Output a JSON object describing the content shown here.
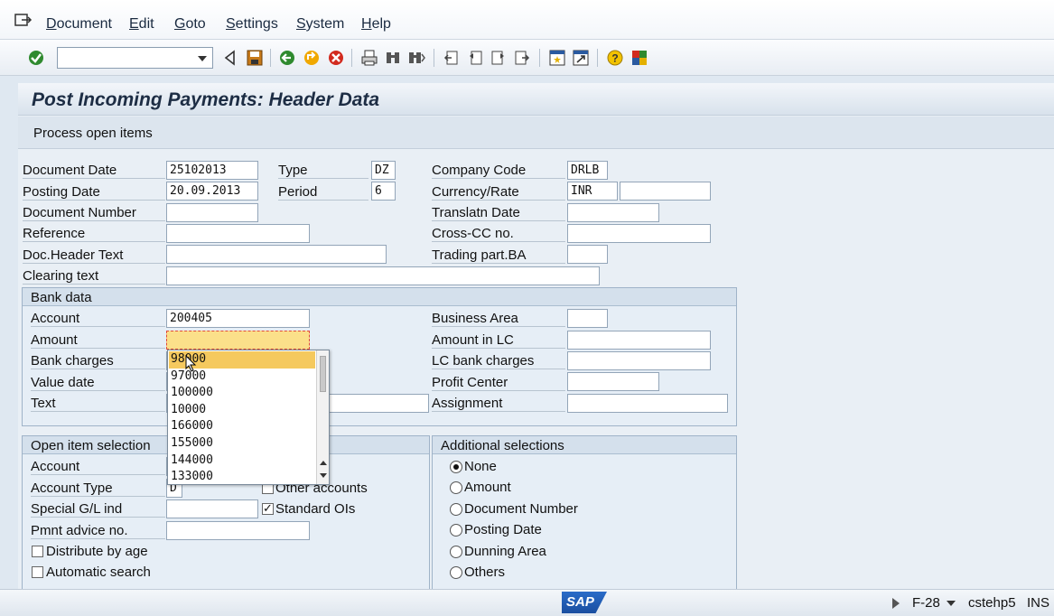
{
  "menu": {
    "icon": "menu-exit-icon",
    "items": [
      "Document",
      "Edit",
      "Goto",
      "Settings",
      "System",
      "Help"
    ]
  },
  "toolbar": {
    "command_value": "",
    "icons": [
      "enter-icon",
      "back-triangle-icon",
      "save-icon",
      "back-icon",
      "exit-icon",
      "cancel-icon",
      "print-icon",
      "find-icon",
      "find-next-icon",
      "first-page-icon",
      "previous-page-icon",
      "next-page-icon",
      "last-page-icon",
      "create-session-icon",
      "shortcut-icon",
      "help-icon",
      "customize-layout-icon"
    ]
  },
  "title": "Post Incoming Payments: Header Data",
  "app_toolbar": {
    "process_label": "Process open items"
  },
  "header": {
    "document_date": {
      "label": "Document Date",
      "value": "25102013"
    },
    "type": {
      "label": "Type",
      "value": "DZ"
    },
    "company_code": {
      "label": "Company Code",
      "value": "DRLB"
    },
    "posting_date": {
      "label": "Posting Date",
      "value": "20.09.2013"
    },
    "period": {
      "label": "Period",
      "value": "6"
    },
    "currency_rate": {
      "label": "Currency/Rate",
      "value": "INR",
      "rate": ""
    },
    "document_number": {
      "label": "Document Number",
      "value": ""
    },
    "translatn_date": {
      "label": "Translatn Date",
      "value": ""
    },
    "reference": {
      "label": "Reference",
      "value": ""
    },
    "cross_cc": {
      "label": "Cross-CC no.",
      "value": ""
    },
    "doc_header_text": {
      "label": "Doc.Header Text",
      "value": ""
    },
    "trading_part": {
      "label": "Trading part.BA",
      "value": ""
    },
    "clearing_text": {
      "label": "Clearing text",
      "value": ""
    }
  },
  "bank_data": {
    "title": "Bank data",
    "account": {
      "label": "Account",
      "value": "200405"
    },
    "amount": {
      "label": "Amount",
      "value": ""
    },
    "bank_charges": {
      "label": "Bank charges",
      "value": ""
    },
    "value_date": {
      "label": "Value date",
      "value": ""
    },
    "text": {
      "label": "Text",
      "value": ""
    },
    "business_area": {
      "label": "Business Area",
      "value": ""
    },
    "amount_in_lc": {
      "label": "Amount in LC",
      "value": ""
    },
    "lc_bank_charges": {
      "label": "LC bank charges",
      "value": ""
    },
    "profit_center": {
      "label": "Profit Center",
      "value": ""
    },
    "assignment": {
      "label": "Assignment",
      "value": ""
    }
  },
  "amount_history": [
    "98000",
    "97000",
    "100000",
    "10000",
    "166000",
    "155000",
    "144000",
    "133000"
  ],
  "open_items": {
    "title": "Open item selection",
    "account": {
      "label": "Account",
      "value": ""
    },
    "account_type": {
      "label": "Account Type",
      "value": "D"
    },
    "other_accounts": {
      "label": "Other accounts",
      "checked": false
    },
    "special_gl": {
      "label": "Special G/L ind",
      "value": ""
    },
    "standard_ois": {
      "label": "Standard OIs",
      "checked": true
    },
    "pmnt_advice": {
      "label": "Pmnt advice no.",
      "value": ""
    },
    "distribute_by_age": {
      "label": "Distribute by age",
      "checked": false
    },
    "automatic_search": {
      "label": "Automatic search",
      "checked": false
    }
  },
  "additional": {
    "title": "Additional selections",
    "options": [
      "None",
      "Amount",
      "Document Number",
      "Posting Date",
      "Dunning Area",
      "Others"
    ],
    "selected": "None"
  },
  "status": {
    "logo": "SAP",
    "transaction": "F-28",
    "server": "cstehp5",
    "mode": "INS"
  }
}
